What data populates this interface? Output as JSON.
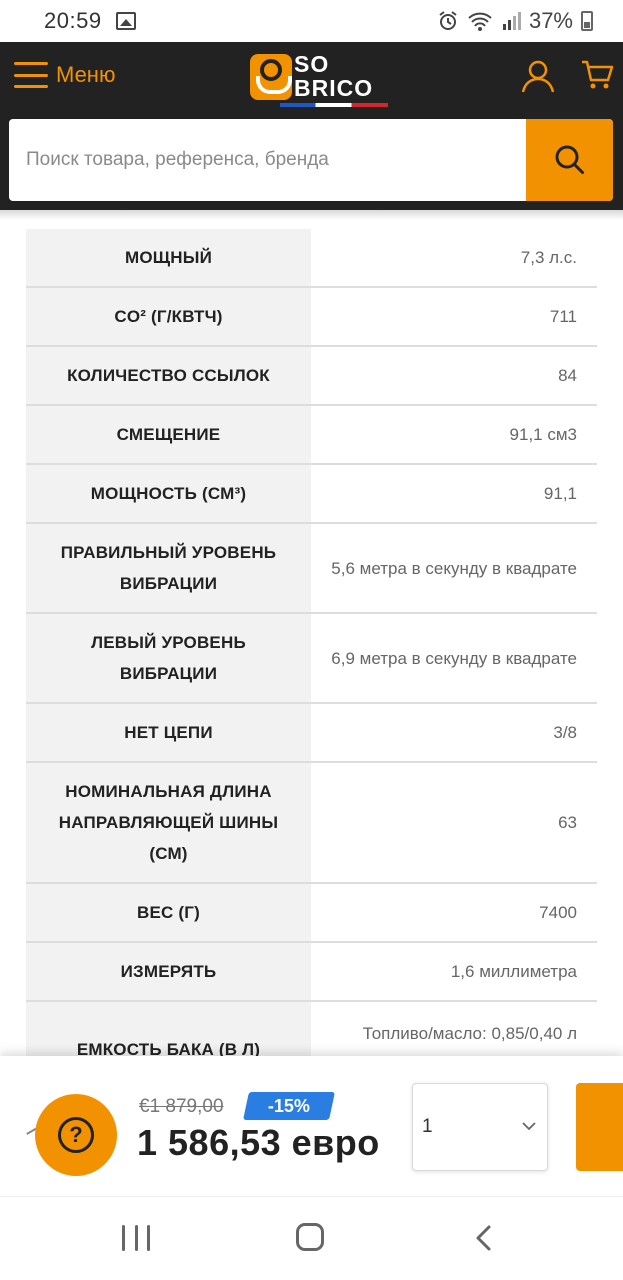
{
  "status_bar": {
    "time": "20:59",
    "battery_percent": "37%",
    "icons": [
      "photo-icon",
      "alarm-icon",
      "wifi-icon",
      "signal-icon",
      "battery-icon"
    ]
  },
  "header": {
    "menu_label": "Меню",
    "logo_text_line1": "SO",
    "logo_text_line2": "BRICO",
    "search_placeholder": "Поиск товара, референса, бренда",
    "icons": [
      "hamburger-menu-icon",
      "user-icon",
      "cart-icon",
      "search-icon"
    ]
  },
  "colors": {
    "accent": "#f39200",
    "header_bg": "#222222",
    "discount_badge": "#2a7de1",
    "label_cell_bg": "#f2f2f2"
  },
  "specs": [
    {
      "label": "МОЩНЫЙ",
      "value": "7,3 л.с."
    },
    {
      "label": "CO² (Г/КВТЧ)",
      "value": "711"
    },
    {
      "label": "КОЛИЧЕСТВО ССЫЛОК",
      "value": "84"
    },
    {
      "label": "СМЕЩЕНИЕ",
      "value": "91,1 см3"
    },
    {
      "label": "МОЩНОСТЬ (СМ³)",
      "value": "91,1"
    },
    {
      "label": "ПРАВИЛЬНЫЙ УРОВЕНЬ ВИБРАЦИИ",
      "value": "5,6 метра в секунду в квадрате"
    },
    {
      "label": "ЛЕВЫЙ УРОВЕНЬ ВИБРАЦИИ",
      "value": "6,9 метра в секунду в квадрате"
    },
    {
      "label": "НЕТ ЦЕПИ",
      "value": "3/8"
    },
    {
      "label": "НОМИНАЛЬНАЯ ДЛИНА НАПРАВЛЯЮЩЕЙ ШИНЫ (СМ)",
      "value": "63"
    },
    {
      "label": "ВЕС (Г)",
      "value": "7400"
    },
    {
      "label": "ИЗМЕРЯТЬ",
      "value": "1,6 миллиметра"
    },
    {
      "label": "ЕМКОСТЬ БАКА (В Л)",
      "value": "Топливо/масло: 0,85/0,40 л"
    }
  ],
  "price_bar": {
    "help_symbol": "?",
    "old_price": "€1 879,00",
    "discount": "-15%",
    "new_price": "1 586,53 евро",
    "quantity": "1"
  },
  "nav_bar": {
    "icons": [
      "recent-apps-icon",
      "home-icon",
      "back-icon"
    ]
  }
}
